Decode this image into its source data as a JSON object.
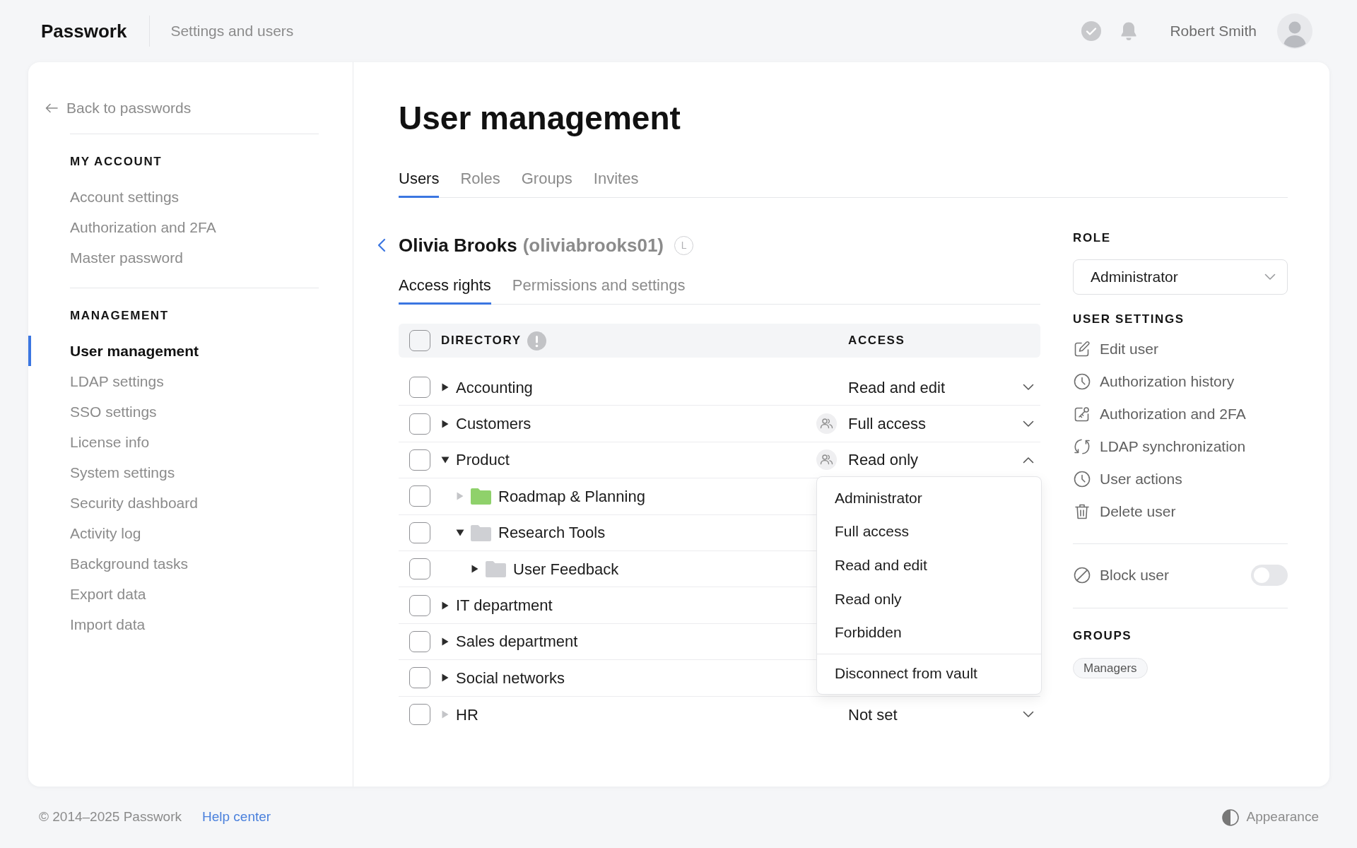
{
  "topbar": {
    "logo": "Passwork",
    "section": "Settings and users",
    "user_name": "Robert Smith"
  },
  "sidebar": {
    "back_link": "Back to passwords",
    "sections": [
      {
        "heading": "MY ACCOUNT",
        "items": [
          {
            "label": "Account settings",
            "selected": false
          },
          {
            "label": "Authorization and 2FA",
            "selected": false
          },
          {
            "label": "Master password",
            "selected": false
          }
        ]
      },
      {
        "heading": "MANAGEMENT",
        "items": [
          {
            "label": "User management",
            "selected": true
          },
          {
            "label": "LDAP settings",
            "selected": false
          },
          {
            "label": "SSO settings",
            "selected": false
          },
          {
            "label": "License info",
            "selected": false
          },
          {
            "label": "System settings",
            "selected": false
          },
          {
            "label": "Security dashboard",
            "selected": false
          },
          {
            "label": "Activity log",
            "selected": false
          },
          {
            "label": "Background tasks",
            "selected": false
          },
          {
            "label": "Export data",
            "selected": false
          },
          {
            "label": "Import data",
            "selected": false
          }
        ]
      }
    ]
  },
  "page": {
    "title": "User management",
    "tabs": [
      {
        "label": "Users",
        "selected": true
      },
      {
        "label": "Roles",
        "selected": false
      },
      {
        "label": "Groups",
        "selected": false
      },
      {
        "label": "Invites",
        "selected": false
      }
    ]
  },
  "user": {
    "name": "Olivia Brooks",
    "login": "(oliviabrooks01)",
    "badge": "L",
    "tabs": [
      {
        "label": "Access rights",
        "selected": true
      },
      {
        "label": "Permissions and settings",
        "selected": false
      }
    ]
  },
  "table": {
    "select_all": {
      "checked": false
    },
    "columns": [
      "DIRECTORY",
      "ACCESS"
    ],
    "rows": [
      {
        "name": "Accounting",
        "checked": false,
        "expandable": true,
        "expanded": false,
        "group_access": false,
        "access": "Read and edit",
        "menu_open": false
      },
      {
        "name": "Customers",
        "checked": false,
        "expandable": true,
        "expanded": false,
        "group_access": true,
        "access": "Full access",
        "menu_open": false
      },
      {
        "name": "Product",
        "checked": false,
        "expandable": true,
        "expanded": true,
        "group_access": true,
        "access": "Read only",
        "menu_open": true,
        "children": [
          {
            "name": "Roadmap & Planning",
            "color": "#8fd16b",
            "checked": false,
            "expandable": false,
            "expanded": false
          },
          {
            "name": "Research Tools",
            "color": "#cfd0d4",
            "checked": false,
            "expandable": true,
            "expanded": true,
            "children": [
              {
                "name": "User Feedback",
                "color": "#cfd0d4",
                "checked": false,
                "expandable": true,
                "expanded": false
              }
            ]
          }
        ]
      },
      {
        "name": "IT department",
        "checked": false,
        "expandable": true,
        "expanded": false
      },
      {
        "name": "Sales department",
        "checked": false,
        "expandable": true,
        "expanded": false
      },
      {
        "name": "Social networks",
        "checked": false,
        "expandable": true,
        "expanded": false
      },
      {
        "name": "HR",
        "checked": false,
        "expandable": false,
        "expanded": false,
        "group_access": false,
        "access": "Not set",
        "menu_open": false
      }
    ],
    "access_menu": {
      "options": [
        "Administrator",
        "Full access",
        "Read and edit",
        "Read only",
        "Forbidden"
      ],
      "actions": [
        "Disconnect from vault"
      ]
    }
  },
  "right_panel": {
    "role": {
      "heading": "ROLE",
      "value": "Administrator"
    },
    "user_settings": {
      "heading": "USER SETTINGS",
      "actions": [
        "Edit user",
        "Authorization history",
        "Authorization and 2FA",
        "LDAP synchronization",
        "User actions",
        "Delete user"
      ]
    },
    "block_user": {
      "label": "Block user",
      "on": false
    },
    "groups": {
      "heading": "GROUPS",
      "items": [
        "Managers"
      ]
    }
  },
  "footer": {
    "copyright": "© 2014–2025 Passwork",
    "help_link": "Help center",
    "appearance": "Appearance"
  }
}
